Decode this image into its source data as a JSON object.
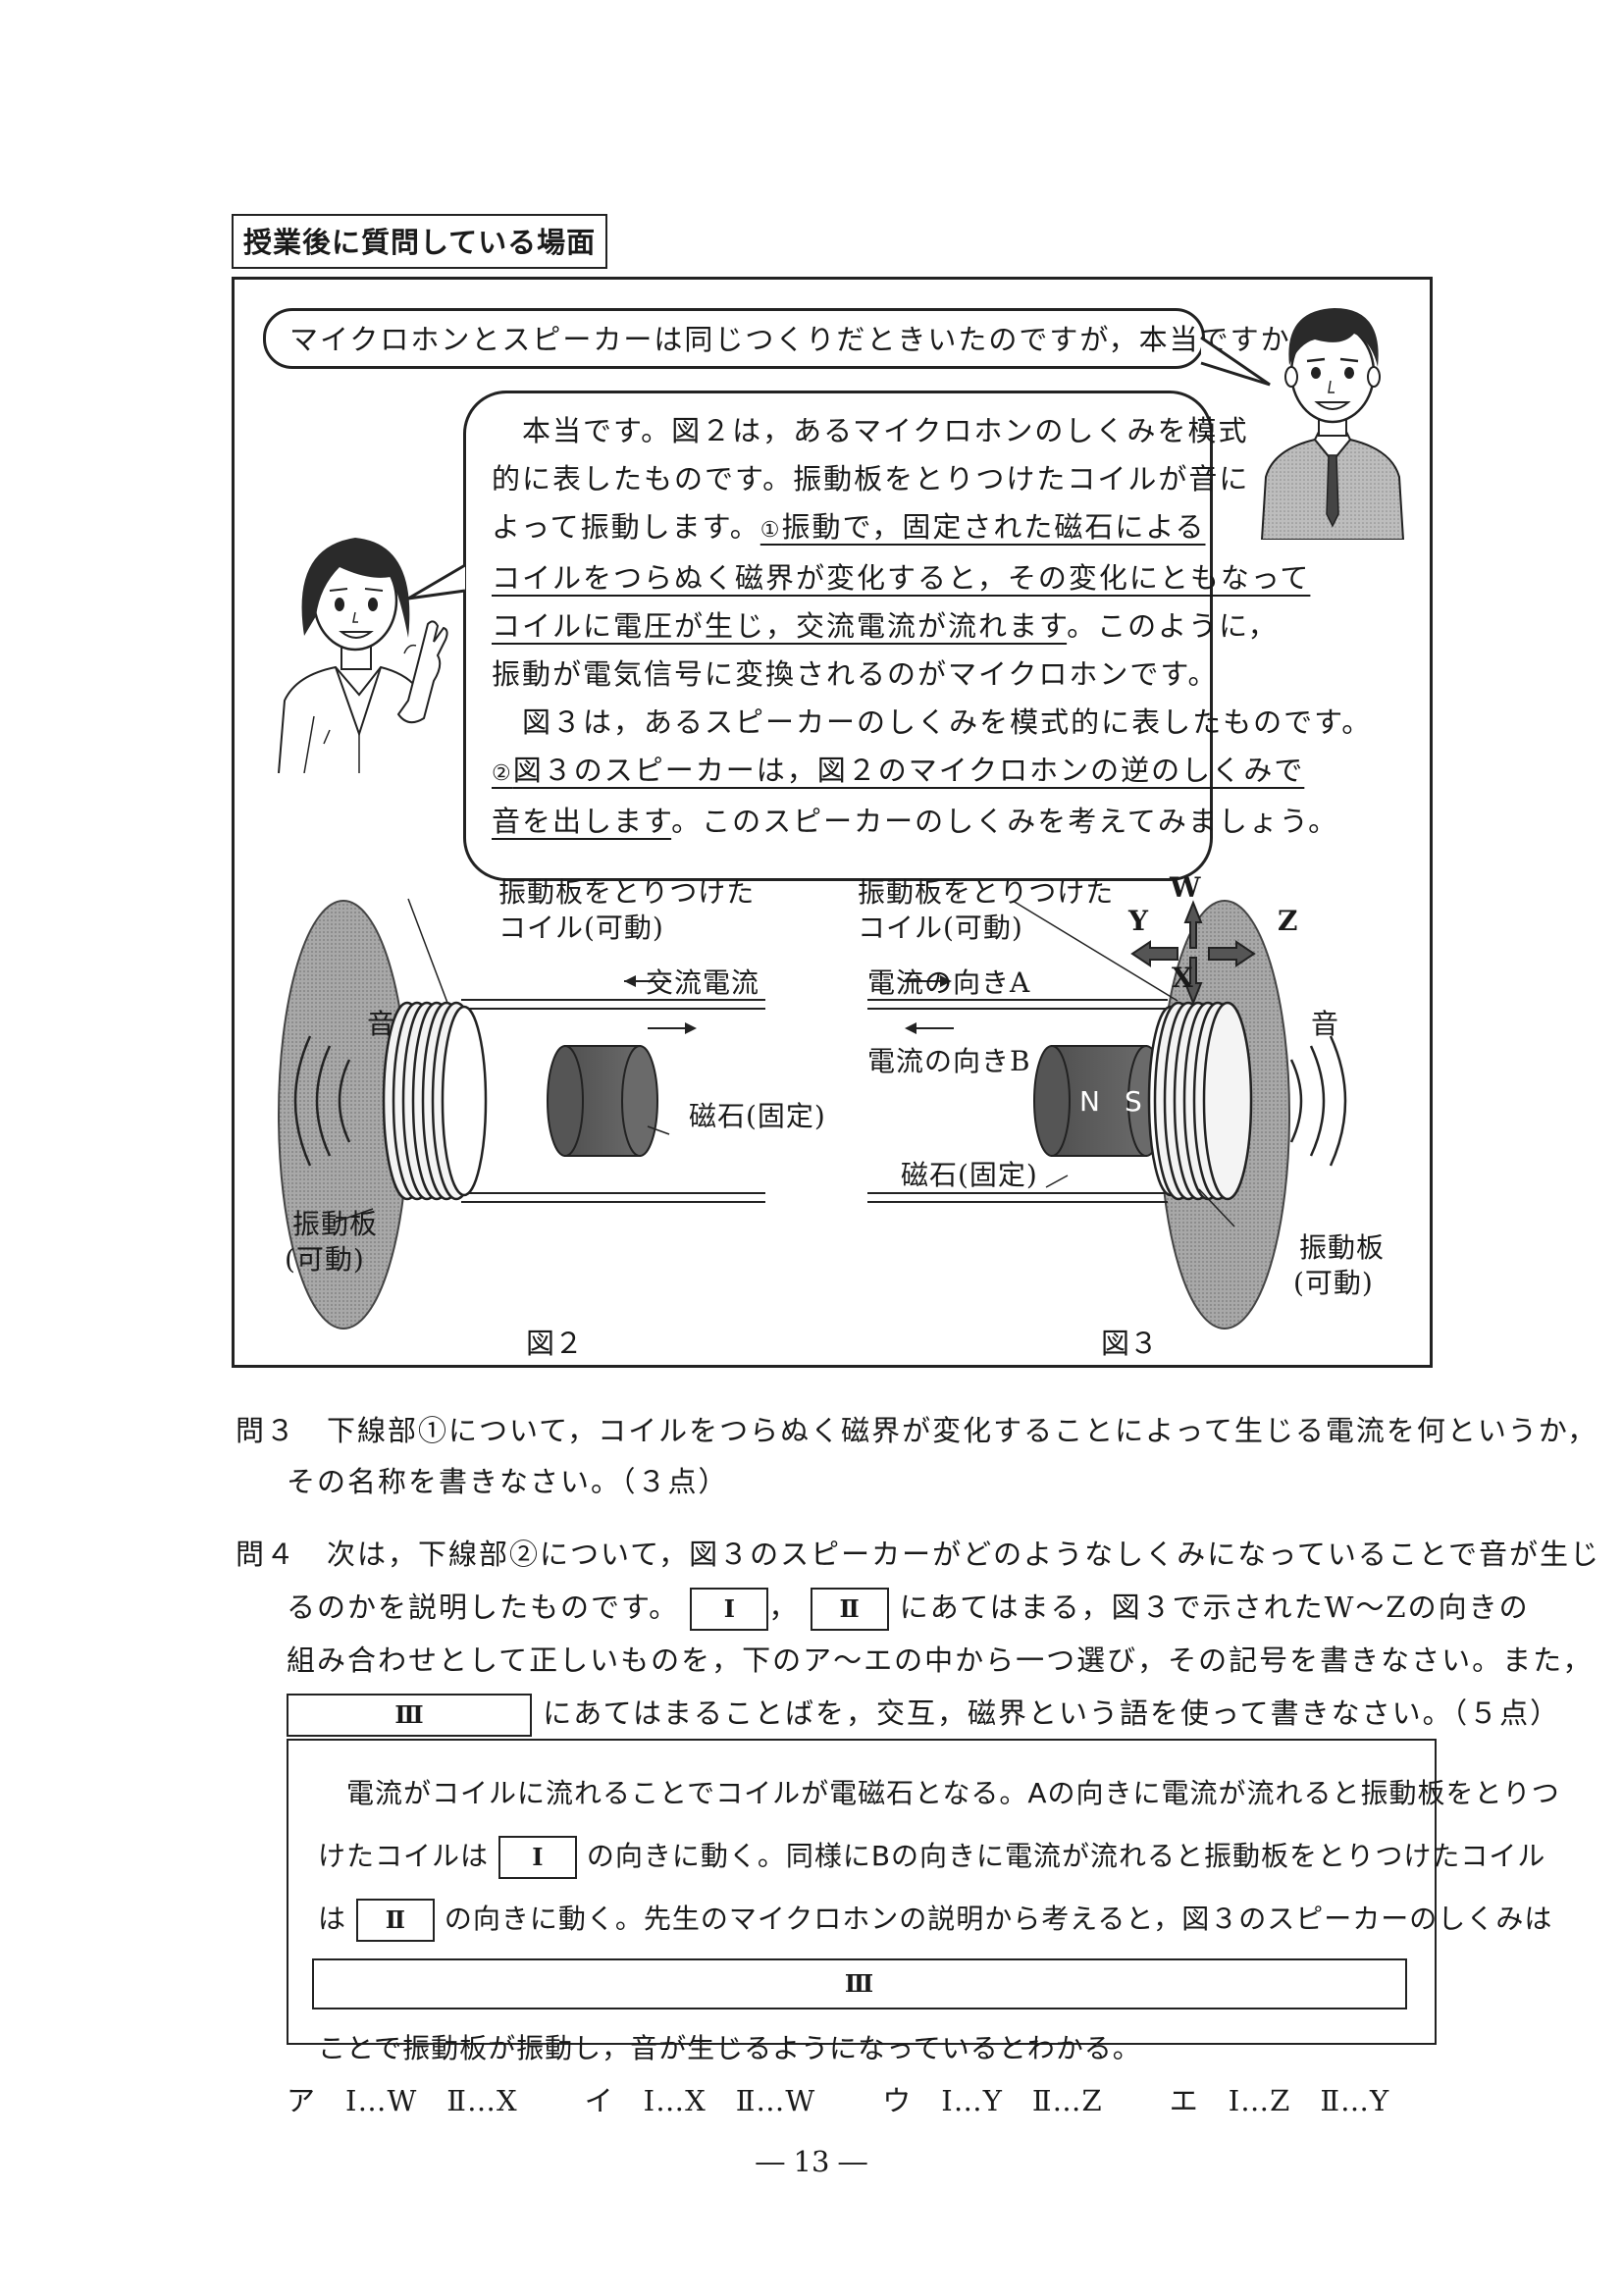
{
  "scene_title": "授業後に質問している場面",
  "student_question": "マイクロホンとスピーカーは同じつくりだときいたのですが，本当ですか。",
  "teacher": {
    "line1": "本当です。図２は，あるマイクロホンのしくみを模式",
    "line2": "的に表したものです。振動板をとりつけたコイルが音に",
    "line3_a": "よって振動します。",
    "circle1": "①",
    "line3_b": "振動で，固定された磁石による",
    "line4": "コイルをつらぬく磁界が変化すると，その変化にともなって",
    "line5_u": "コイルに電圧が生じ，交流電流が流れます",
    "line5_b": "。このように，",
    "line6": "振動が電気信号に変換されるのがマイクロホンです。",
    "line7": "図３は，あるスピーカーのしくみを模式的に表したものです。",
    "circle2": "②",
    "line8_u": "図３のスピーカーは，図２のマイクロホンの逆のしくみで",
    "line9_u": "音を出します",
    "line9_b": "。このスピーカーのしくみを考えてみましょう。"
  },
  "fig2": {
    "coil_label_1": "振動板をとりつけた",
    "coil_label_2": "コイル(可動)",
    "ac_label": "交流電流",
    "sound_label": "音",
    "magnet_label": "磁石(固定)",
    "plate_label_1": "振動板",
    "plate_label_2": "(可動)",
    "caption": "図２"
  },
  "fig3": {
    "coil_label_1": "振動板をとりつけた",
    "coil_label_2": "コイル(可動)",
    "dir_a": "電流の向きA",
    "dir_b": "電流の向きB",
    "w": "W",
    "x": "X",
    "y": "Y",
    "z": "Z",
    "sound_label": "音",
    "n": "N",
    "s": "S",
    "magnet_label": "磁石(固定)",
    "plate_label_1": "振動板",
    "plate_label_2": "(可動)",
    "caption": "図３"
  },
  "q3": {
    "num": "問３",
    "line1": "下線部①について，コイルをつらぬく磁界が変化することによって生じる電流を何というか，",
    "line2": "その名称を書きなさい。（３点）"
  },
  "q4": {
    "num": "問４",
    "line1": "次は，下線部②について，図３のスピーカーがどのようなしくみになっていることで音が生じ",
    "line2_a": "るのかを説明したものです。",
    "box1": "Ⅰ",
    "comma": "，",
    "box2": "Ⅱ",
    "line2_b": "にあてはまる，図３で示されたW～Zの向きの",
    "line3": "組み合わせとして正しいものを，下のア～エの中から一つ選び，その記号を書きなさい。また，",
    "box3": "Ⅲ",
    "line4": "にあてはまることばを，交互，磁界という語を使って書きなさい。（５点）"
  },
  "explanation": {
    "line1": "電流がコイルに流れることでコイルが電磁石となる。Aの向きに電流が流れると振動板をとりつ",
    "line2_a": "けたコイルは",
    "box1": "Ⅰ",
    "line2_b": "の向きに動く。同様にBの向きに電流が流れると振動板をとりつけたコイル",
    "line3_a": "は",
    "box2": "Ⅱ",
    "line3_b": "の向きに動く。先生のマイクロホンの説明から考えると，図３のスピーカーのしくみは",
    "box3": "Ⅲ",
    "line4": "ことで振動板が振動し，音が生じるようになっているとわかる。"
  },
  "choices": [
    "ア　Ⅰ…W　Ⅱ…X",
    "イ　Ⅰ…X　Ⅱ…W",
    "ウ　Ⅰ…Y　Ⅱ…Z",
    "エ　Ⅰ…Z　Ⅱ…Y"
  ],
  "page_number": "― 13 ―"
}
